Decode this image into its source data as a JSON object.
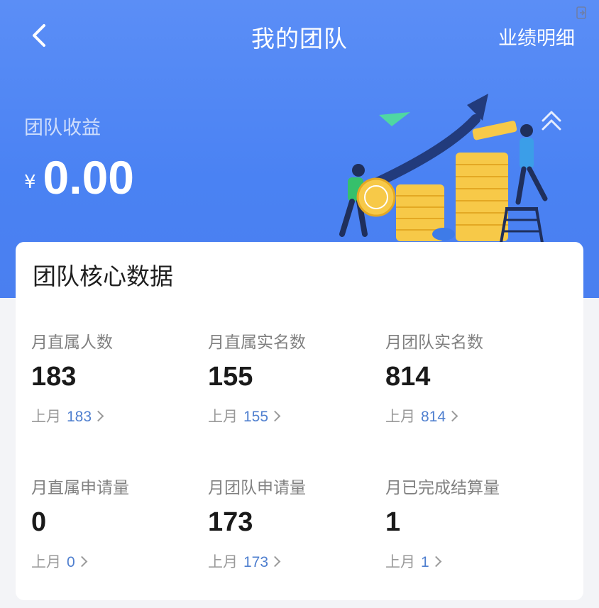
{
  "header": {
    "title": "我的团队",
    "detail_link": "业绩明细"
  },
  "income": {
    "label": "团队收益",
    "currency": "¥",
    "value": "0.00"
  },
  "card": {
    "title": "团队核心数据",
    "metrics": [
      {
        "label": "月直属人数",
        "value": "183",
        "last_label": "上月",
        "last_value": "183"
      },
      {
        "label": "月直属实名数",
        "value": "155",
        "last_label": "上月",
        "last_value": "155"
      },
      {
        "label": "月团队实名数",
        "value": "814",
        "last_label": "上月",
        "last_value": "814"
      },
      {
        "label": "月直属申请量",
        "value": "0",
        "last_label": "上月",
        "last_value": "0"
      },
      {
        "label": "月团队申请量",
        "value": "173",
        "last_label": "上月",
        "last_value": "173"
      },
      {
        "label": "月已完成结算量",
        "value": "1",
        "last_label": "上月",
        "last_value": "1"
      }
    ]
  },
  "icons": {
    "back": "chevron-left-icon",
    "exit": "exit-icon",
    "scroll_up": "double-chevron-up-icon",
    "last_month_arrow": "chevron-right-icon"
  },
  "colors": {
    "header_blue": "#4a82f3",
    "link_blue": "#4f7fcf",
    "coin_gold": "#f7c948",
    "arrow_navy": "#213a7a"
  }
}
